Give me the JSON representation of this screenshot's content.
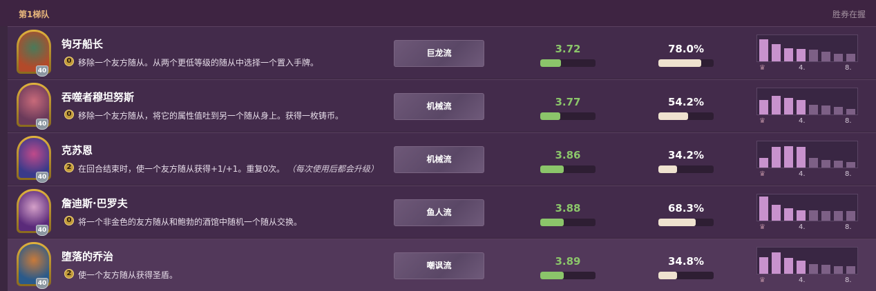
{
  "header": {
    "tier_label": "第1梯队",
    "winrate_label": "胜券在握"
  },
  "colors": {
    "placement": "#8bc56a",
    "winrate_bar": "#efe2cf",
    "dist_top": "#c892cd",
    "dist_bottom": "#7d6086",
    "gold": "#e8b77c"
  },
  "dist_axis": {
    "first_icon": "crown-icon",
    "mid": "4.",
    "last": "8."
  },
  "heroes": [
    {
      "name": "钩牙船长",
      "armor": "40",
      "cost": "0",
      "power": "移除一个友方随从。从两个更低等级的随从中选择一个置入手牌。",
      "power_hint": "",
      "comp": "巨龙流",
      "placement": "3.72",
      "placement_fill": 0.38,
      "winrate": "78.0%",
      "winrate_fill": 0.78,
      "distribution": [
        0.85,
        0.65,
        0.5,
        0.48,
        0.45,
        0.38,
        0.3,
        0.28
      ],
      "portrait": [
        "#b34a2a",
        "#4a7a5a"
      ]
    },
    {
      "name": "吞噬者穆坦努斯",
      "armor": "40",
      "cost": "0",
      "power": "移除一个友方随从，将它的属性值吐到另一个随从身上。获得一枚铸币。",
      "power_hint": "",
      "comp": "机械流",
      "placement": "3.77",
      "placement_fill": 0.36,
      "winrate": "54.2%",
      "winrate_fill": 0.54,
      "distribution": [
        0.55,
        0.72,
        0.62,
        0.55,
        0.38,
        0.35,
        0.28,
        0.22
      ],
      "portrait": [
        "#6a3a5a",
        "#c86a7a"
      ]
    },
    {
      "name": "克苏恩",
      "armor": "40",
      "cost": "2",
      "power": "在回合结束时，使一个友方随从获得+1/+1。重复0次。",
      "power_hint": "（每次使用后都会升级）",
      "comp": "机械流",
      "placement": "3.86",
      "placement_fill": 0.42,
      "winrate": "34.2%",
      "winrate_fill": 0.34,
      "distribution": [
        0.38,
        0.8,
        0.82,
        0.8,
        0.38,
        0.3,
        0.25,
        0.22
      ],
      "portrait": [
        "#3a3a8a",
        "#c04a8a"
      ]
    },
    {
      "name": "詹迪斯·巴罗夫",
      "armor": "40",
      "cost": "0",
      "power": "将一个非金色的友方随从和鲍勃的酒馆中随机一个随从交换。",
      "power_hint": "",
      "comp": "鱼人流",
      "placement": "3.88",
      "placement_fill": 0.42,
      "winrate": "68.3%",
      "winrate_fill": 0.68,
      "distribution": [
        0.92,
        0.6,
        0.48,
        0.4,
        0.4,
        0.38,
        0.38,
        0.36
      ],
      "portrait": [
        "#5a2a7a",
        "#d4a0c8"
      ]
    },
    {
      "name": "堕落的乔治",
      "armor": "40",
      "cost": "2",
      "power": "使一个友方随从获得圣盾。",
      "power_hint": "",
      "comp": "嘲讽流",
      "placement": "3.89",
      "placement_fill": 0.42,
      "winrate": "34.8%",
      "winrate_fill": 0.34,
      "distribution": [
        0.62,
        0.82,
        0.6,
        0.5,
        0.38,
        0.35,
        0.3,
        0.28
      ],
      "portrait": [
        "#2a5a8a",
        "#c87a3a"
      ]
    }
  ]
}
